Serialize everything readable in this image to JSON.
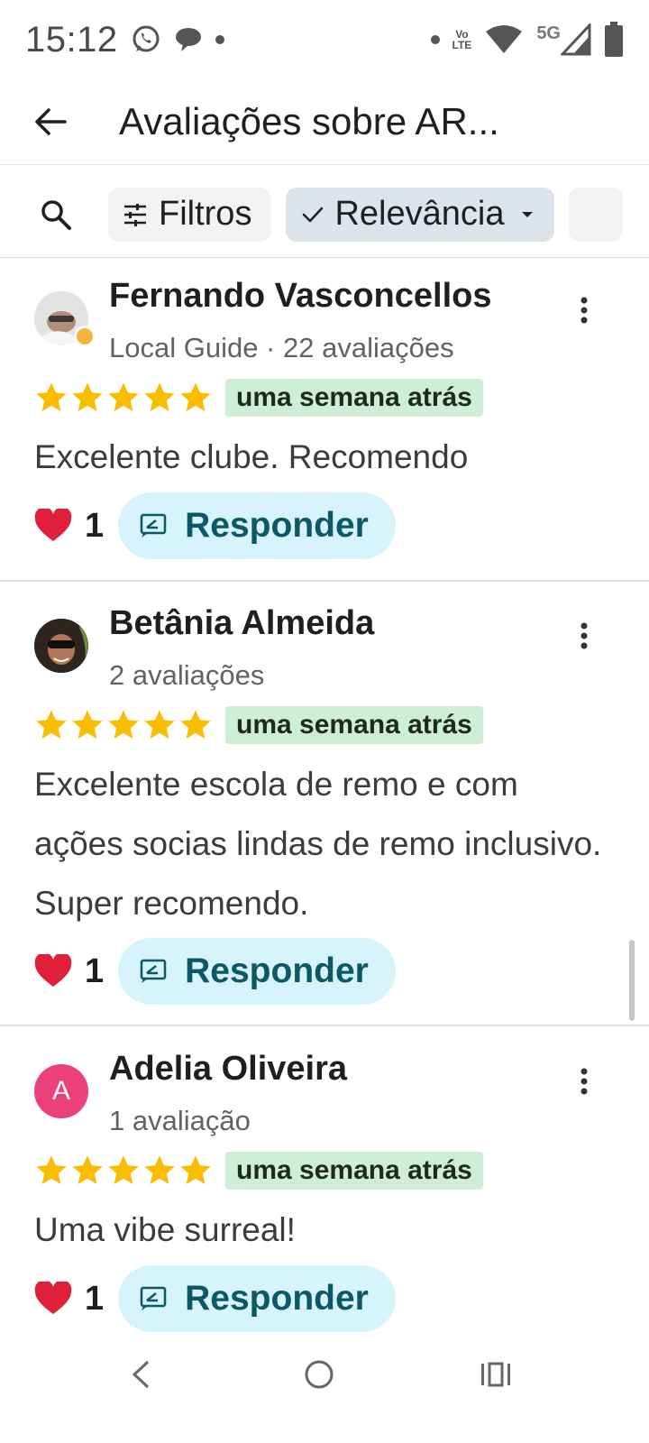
{
  "status_bar": {
    "time": "15:12",
    "network_5g": "5G",
    "volte_top": "Vo",
    "volte_bottom": "LTE"
  },
  "app_bar": {
    "title": "Avaliações sobre AR..."
  },
  "filters": {
    "filtros_label": "Filtros",
    "sort_label": "Relevância"
  },
  "reviews": [
    {
      "name": "Fernando Vasconcellos",
      "meta": "Local Guide · 22 avaliações",
      "rating": 5,
      "date": "uma semana atrás",
      "text": "Excelente clube. Recomendo",
      "likes": "1",
      "reply_label": "Responder",
      "avatar_icon": "photo-avatar-icon",
      "local_guide": true
    },
    {
      "name": "Betânia Almeida",
      "meta": "2 avaliações",
      "rating": 5,
      "date": "uma semana atrás",
      "text": "Excelente escola de remo e com ações socias lindas de remo inclusivo. Super recomendo.",
      "likes": "1",
      "reply_label": "Responder",
      "avatar_icon": "photo-avatar-icon",
      "local_guide": false
    },
    {
      "name": "Adelia Oliveira",
      "meta": "1 avaliação",
      "rating": 5,
      "date": "uma semana atrás",
      "text": "Uma vibe surreal!",
      "likes": "1",
      "reply_label": "Responder",
      "avatar_letter": "A",
      "local_guide": false
    }
  ],
  "colors": {
    "star": "#fbbc04",
    "date_badge": "#cfeed6",
    "reply_button": "#d7f3fb",
    "reply_text": "#0b5966",
    "heart": "#e0203a",
    "letter_avatar": "#ec407a",
    "guide_badge": "#f6b43b"
  }
}
